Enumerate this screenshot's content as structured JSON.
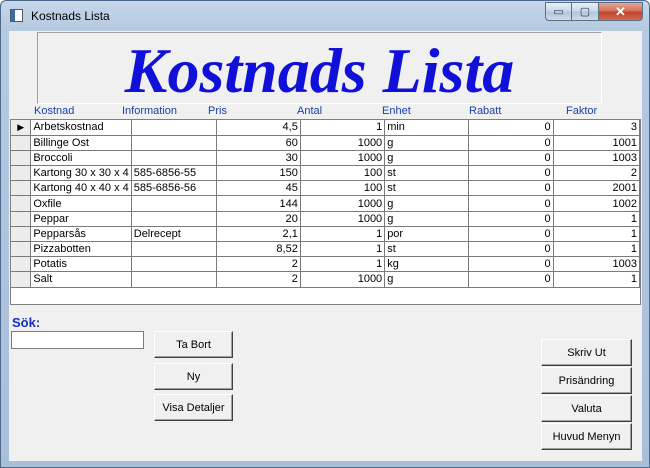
{
  "window": {
    "title": "Kostnads Lista",
    "close_glyph": "✕",
    "minimize_glyph": "▭",
    "maximize_glyph": "▢"
  },
  "header": {
    "title": "Kostnads Lista"
  },
  "columns": [
    "Kostnad",
    "Information",
    "Pris",
    "Antal",
    "Enhet",
    "Rabatt",
    "Faktor"
  ],
  "rows": [
    {
      "current": true,
      "kostnad": "Arbetskostnad",
      "information": "",
      "pris": "4,5",
      "antal": "1",
      "enhet": "min",
      "rabatt": "0",
      "faktor": "3"
    },
    {
      "current": false,
      "kostnad": "Billinge Ost",
      "information": "",
      "pris": "60",
      "antal": "1000",
      "enhet": "g",
      "rabatt": "0",
      "faktor": "1001"
    },
    {
      "current": false,
      "kostnad": "Broccoli",
      "information": "",
      "pris": "30",
      "antal": "1000",
      "enhet": "g",
      "rabatt": "0",
      "faktor": "1003"
    },
    {
      "current": false,
      "kostnad": "Kartong 30 x 30 x 4",
      "information": "585-6856-55",
      "pris": "150",
      "antal": "100",
      "enhet": "st",
      "rabatt": "0",
      "faktor": "2"
    },
    {
      "current": false,
      "kostnad": "Kartong 40 x 40 x 4",
      "information": "585-6856-56",
      "pris": "45",
      "antal": "100",
      "enhet": "st",
      "rabatt": "0",
      "faktor": "2001"
    },
    {
      "current": false,
      "kostnad": "Oxfile",
      "information": "",
      "pris": "144",
      "antal": "1000",
      "enhet": "g",
      "rabatt": "0",
      "faktor": "1002"
    },
    {
      "current": false,
      "kostnad": "Peppar",
      "information": "",
      "pris": "20",
      "antal": "1000",
      "enhet": "g",
      "rabatt": "0",
      "faktor": "1"
    },
    {
      "current": false,
      "kostnad": "Pepparsås",
      "information": "Delrecept",
      "pris": "2,1",
      "antal": "1",
      "enhet": "por",
      "rabatt": "0",
      "faktor": "1"
    },
    {
      "current": false,
      "kostnad": "Pizzabotten",
      "information": "",
      "pris": "8,52",
      "antal": "1",
      "enhet": "st",
      "rabatt": "0",
      "faktor": "1"
    },
    {
      "current": false,
      "kostnad": "Potatis",
      "information": "",
      "pris": "2",
      "antal": "1",
      "enhet": "kg",
      "rabatt": "0",
      "faktor": "1003"
    },
    {
      "current": false,
      "kostnad": "Salt",
      "information": "",
      "pris": "2",
      "antal": "1000",
      "enhet": "g",
      "rabatt": "0",
      "faktor": "1"
    }
  ],
  "search": {
    "label": "Sök:",
    "value": "",
    "placeholder": ""
  },
  "buttons": {
    "ta_bort": "Ta Bort",
    "ny": "Ny",
    "visa_detaljer": "Visa Detaljer",
    "skriv_ut": "Skriv Ut",
    "prisandring": "Prisändring",
    "valuta": "Valuta",
    "huvud_menyn": "Huvud Menyn"
  },
  "icons": {
    "row_pointer": "▶",
    "scroll_left": "◀",
    "scroll_right": "▶"
  },
  "colors": {
    "title_blue": "#1010d8",
    "header_blue": "#1a3fa8"
  }
}
